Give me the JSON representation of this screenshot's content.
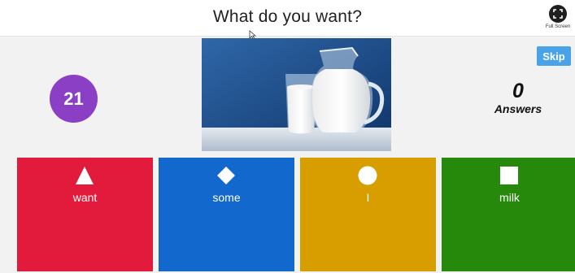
{
  "header": {
    "question": "What do you want?",
    "fullscreen_label": "Full Screen"
  },
  "game": {
    "timer": "21",
    "skip_label": "Skip",
    "answers_count": "0",
    "answers_label": "Answers",
    "image_icon": "milk-jug-and-glass-photo"
  },
  "answers": [
    {
      "label": "want",
      "shape": "triangle-icon",
      "color": "#e21b3c"
    },
    {
      "label": "some",
      "shape": "diamond-icon",
      "color": "#1368ce"
    },
    {
      "label": "I",
      "shape": "circle-icon",
      "color": "#d89e00"
    },
    {
      "label": "milk",
      "shape": "square-icon",
      "color": "#26890c"
    }
  ]
}
